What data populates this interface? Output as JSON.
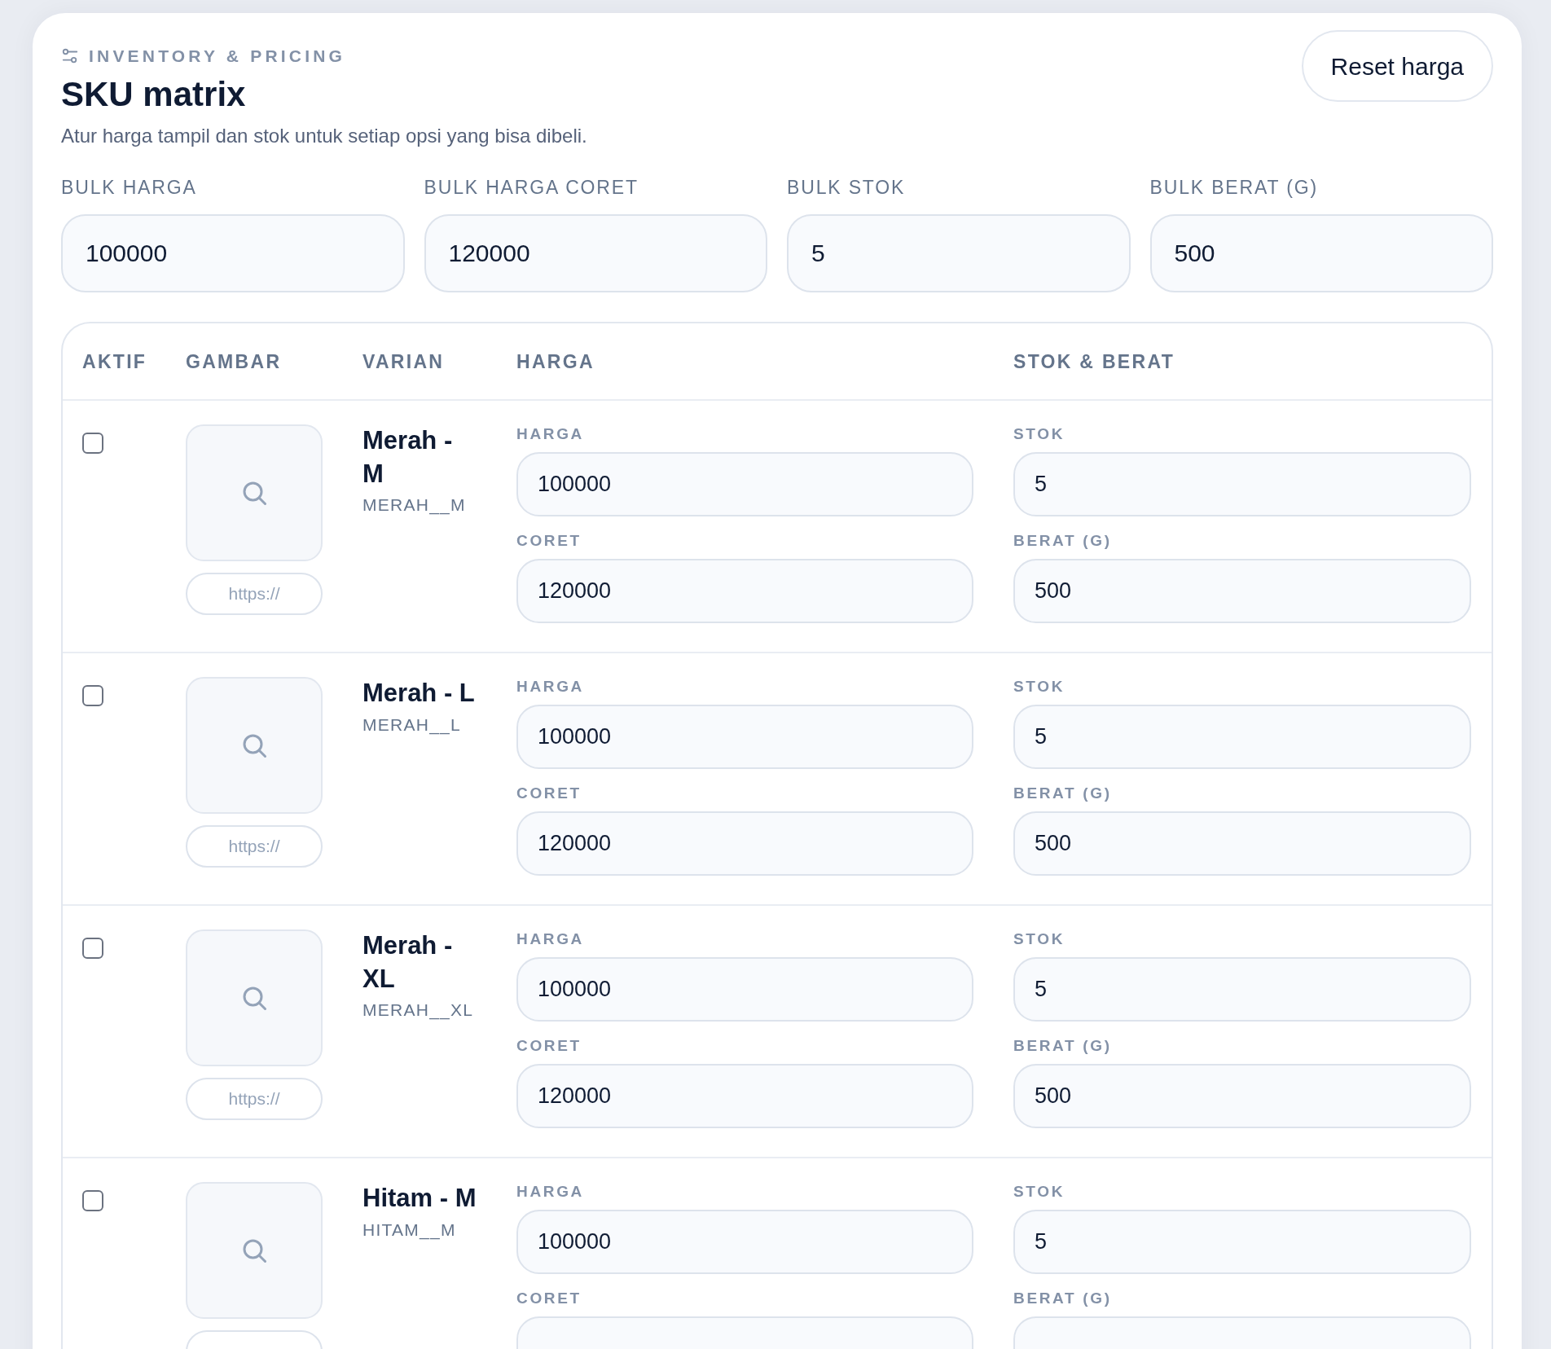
{
  "header": {
    "eyebrow": "INVENTORY & PRICING",
    "title": "SKU matrix",
    "subtitle": "Atur harga tampil dan stok untuk setiap opsi yang bisa dibeli.",
    "reset_button": "Reset harga"
  },
  "bulk_fields": [
    {
      "label": "BULK HARGA",
      "value": "100000"
    },
    {
      "label": "BULK HARGA CORET",
      "value": "120000"
    },
    {
      "label": "BULK STOK",
      "value": "5"
    },
    {
      "label": "BULK BERAT (G)",
      "value": "500"
    }
  ],
  "table": {
    "columns": [
      "AKTIF",
      "GAMBAR",
      "VARIAN",
      "HARGA",
      "STOK & BERAT"
    ],
    "rows": [
      {
        "active": false,
        "image_url_placeholder": "https://",
        "name": "Merah - M",
        "code": "MERAH__M",
        "fields": [
          {
            "label": "HARGA",
            "value": "100000"
          },
          {
            "label": "CORET",
            "value": "120000"
          },
          {
            "label": "STOK",
            "value": "5"
          },
          {
            "label": "BERAT (G)",
            "value": "500"
          }
        ]
      },
      {
        "active": false,
        "image_url_placeholder": "https://",
        "name": "Merah - L",
        "code": "MERAH__L",
        "fields": [
          {
            "label": "HARGA",
            "value": "100000"
          },
          {
            "label": "CORET",
            "value": "120000"
          },
          {
            "label": "STOK",
            "value": "5"
          },
          {
            "label": "BERAT (G)",
            "value": "500"
          }
        ]
      },
      {
        "active": false,
        "image_url_placeholder": "https://",
        "name": "Merah - XL",
        "code": "MERAH__XL",
        "fields": [
          {
            "label": "HARGA",
            "value": "100000"
          },
          {
            "label": "CORET",
            "value": "120000"
          },
          {
            "label": "STOK",
            "value": "5"
          },
          {
            "label": "BERAT (G)",
            "value": "500"
          }
        ]
      },
      {
        "active": false,
        "name": "Hitam - M",
        "code": "HITAM__M",
        "fields": [
          {
            "label": "HARGA",
            "value": "100000"
          },
          {
            "label": "CORET"
          },
          {
            "label": "STOK",
            "value": "5"
          },
          {
            "label": "BERAT (G)"
          }
        ]
      }
    ]
  }
}
